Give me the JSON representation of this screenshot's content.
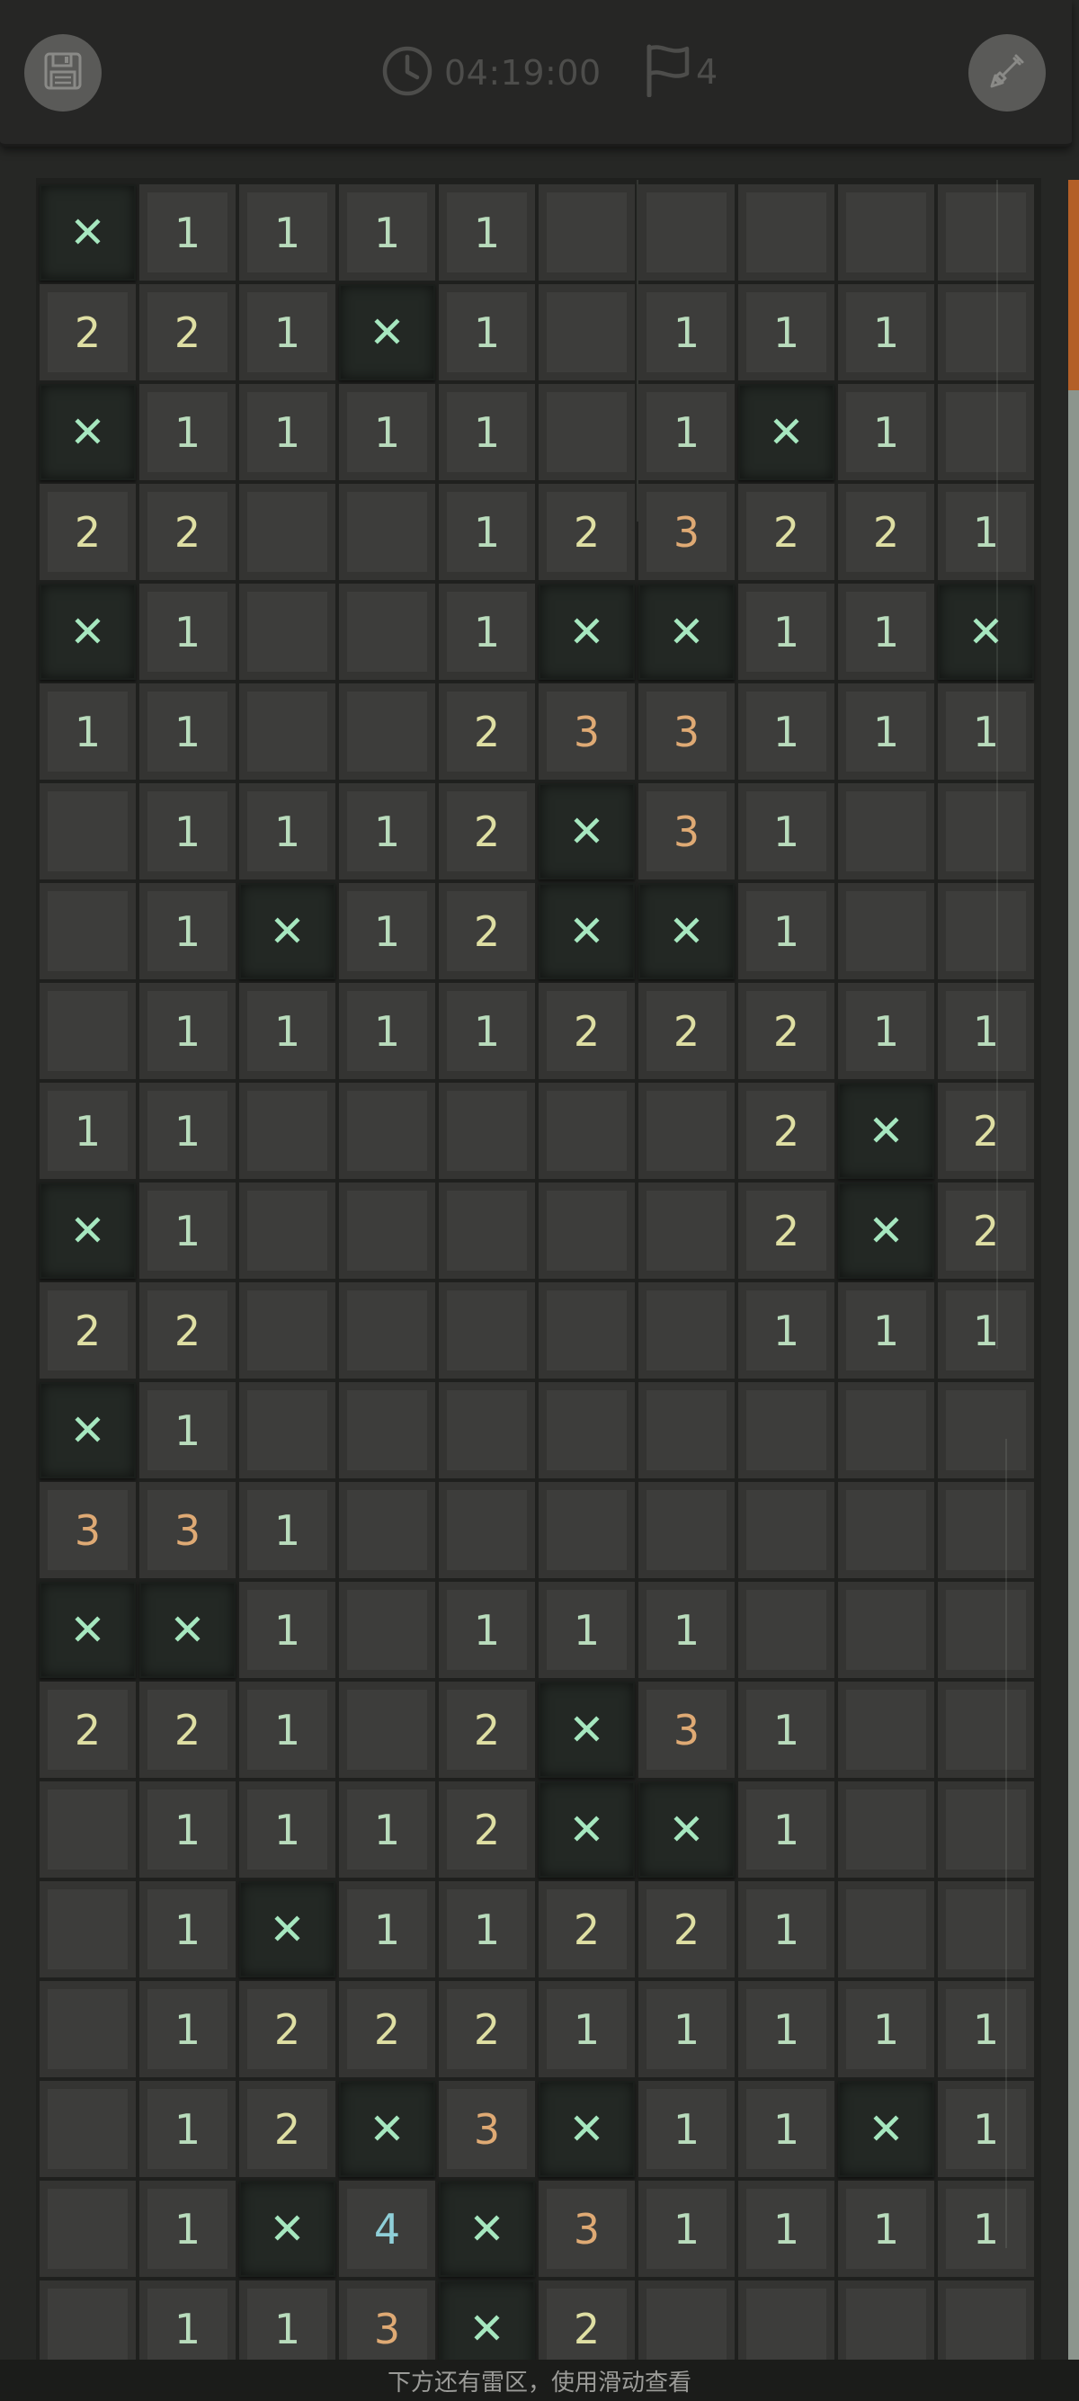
{
  "toolbar": {
    "save_icon": "floppy-disk-icon",
    "timer_icon": "clock-icon",
    "timer": "04:19:00",
    "flag_icon": "flag-icon",
    "flags": "4",
    "dig_icon": "shovel-icon"
  },
  "board": {
    "columns": 10,
    "legend": {
      "M": "flagged mine",
      "E": "empty revealed",
      "H": "unrevealed"
    },
    "rows": [
      [
        "M",
        "1",
        "1",
        "1",
        "1",
        "H",
        "H",
        "H",
        "H",
        "H"
      ],
      [
        "2",
        "2",
        "1",
        "M",
        "1",
        "E",
        "1",
        "1",
        "1",
        "H"
      ],
      [
        "M",
        "1",
        "1",
        "1",
        "1",
        "E",
        "1",
        "M",
        "1",
        "H"
      ],
      [
        "2",
        "2",
        "E",
        "E",
        "1",
        "2",
        "3",
        "2",
        "2",
        "1"
      ],
      [
        "M",
        "1",
        "E",
        "E",
        "1",
        "M",
        "M",
        "1",
        "1",
        "M"
      ],
      [
        "1",
        "1",
        "E",
        "E",
        "2",
        "3",
        "3",
        "1",
        "1",
        "1"
      ],
      [
        "E",
        "1",
        "1",
        "1",
        "2",
        "M",
        "3",
        "1",
        "E",
        "E"
      ],
      [
        "E",
        "1",
        "M",
        "1",
        "2",
        "M",
        "M",
        "1",
        "E",
        "E"
      ],
      [
        "E",
        "1",
        "1",
        "1",
        "1",
        "2",
        "2",
        "2",
        "1",
        "1"
      ],
      [
        "1",
        "1",
        "E",
        "E",
        "E",
        "E",
        "E",
        "2",
        "M",
        "2"
      ],
      [
        "M",
        "1",
        "E",
        "E",
        "E",
        "E",
        "E",
        "2",
        "M",
        "2"
      ],
      [
        "2",
        "2",
        "E",
        "E",
        "E",
        "E",
        "E",
        "1",
        "1",
        "1"
      ],
      [
        "M",
        "1",
        "E",
        "E",
        "E",
        "E",
        "E",
        "E",
        "E",
        "E"
      ],
      [
        "3",
        "3",
        "1",
        "E",
        "E",
        "E",
        "E",
        "E",
        "E",
        "E"
      ],
      [
        "M",
        "M",
        "1",
        "E",
        "1",
        "1",
        "1",
        "E",
        "E",
        "E"
      ],
      [
        "2",
        "2",
        "1",
        "E",
        "2",
        "M",
        "3",
        "1",
        "E",
        "E"
      ],
      [
        "E",
        "1",
        "1",
        "1",
        "2",
        "M",
        "M",
        "1",
        "E",
        "E"
      ],
      [
        "E",
        "1",
        "M",
        "1",
        "1",
        "2",
        "2",
        "1",
        "E",
        "E"
      ],
      [
        "E",
        "1",
        "2",
        "2",
        "2",
        "1",
        "1",
        "1",
        "1",
        "1"
      ],
      [
        "E",
        "1",
        "2",
        "M",
        "3",
        "M",
        "1",
        "1",
        "M",
        "1"
      ],
      [
        "E",
        "1",
        "M",
        "4",
        "M",
        "3",
        "1",
        "1",
        "1",
        "1"
      ],
      [
        "E",
        "1",
        "1",
        "3",
        "M",
        "2",
        "E",
        "E",
        "E",
        "E"
      ]
    ]
  },
  "footer": {
    "hint": "下方还有雷区，使用滑动查看"
  },
  "colors": {
    "mine_cell": "#232824",
    "mine_mark": "#a6e7bf",
    "cell": "#3d3d3b",
    "number_1": "#b9dcbc",
    "number_2": "#dfdfa3",
    "number_3": "#dfaa74",
    "number_4": "#8fcfd8",
    "scrollbar_thumb": "#b35f27"
  }
}
